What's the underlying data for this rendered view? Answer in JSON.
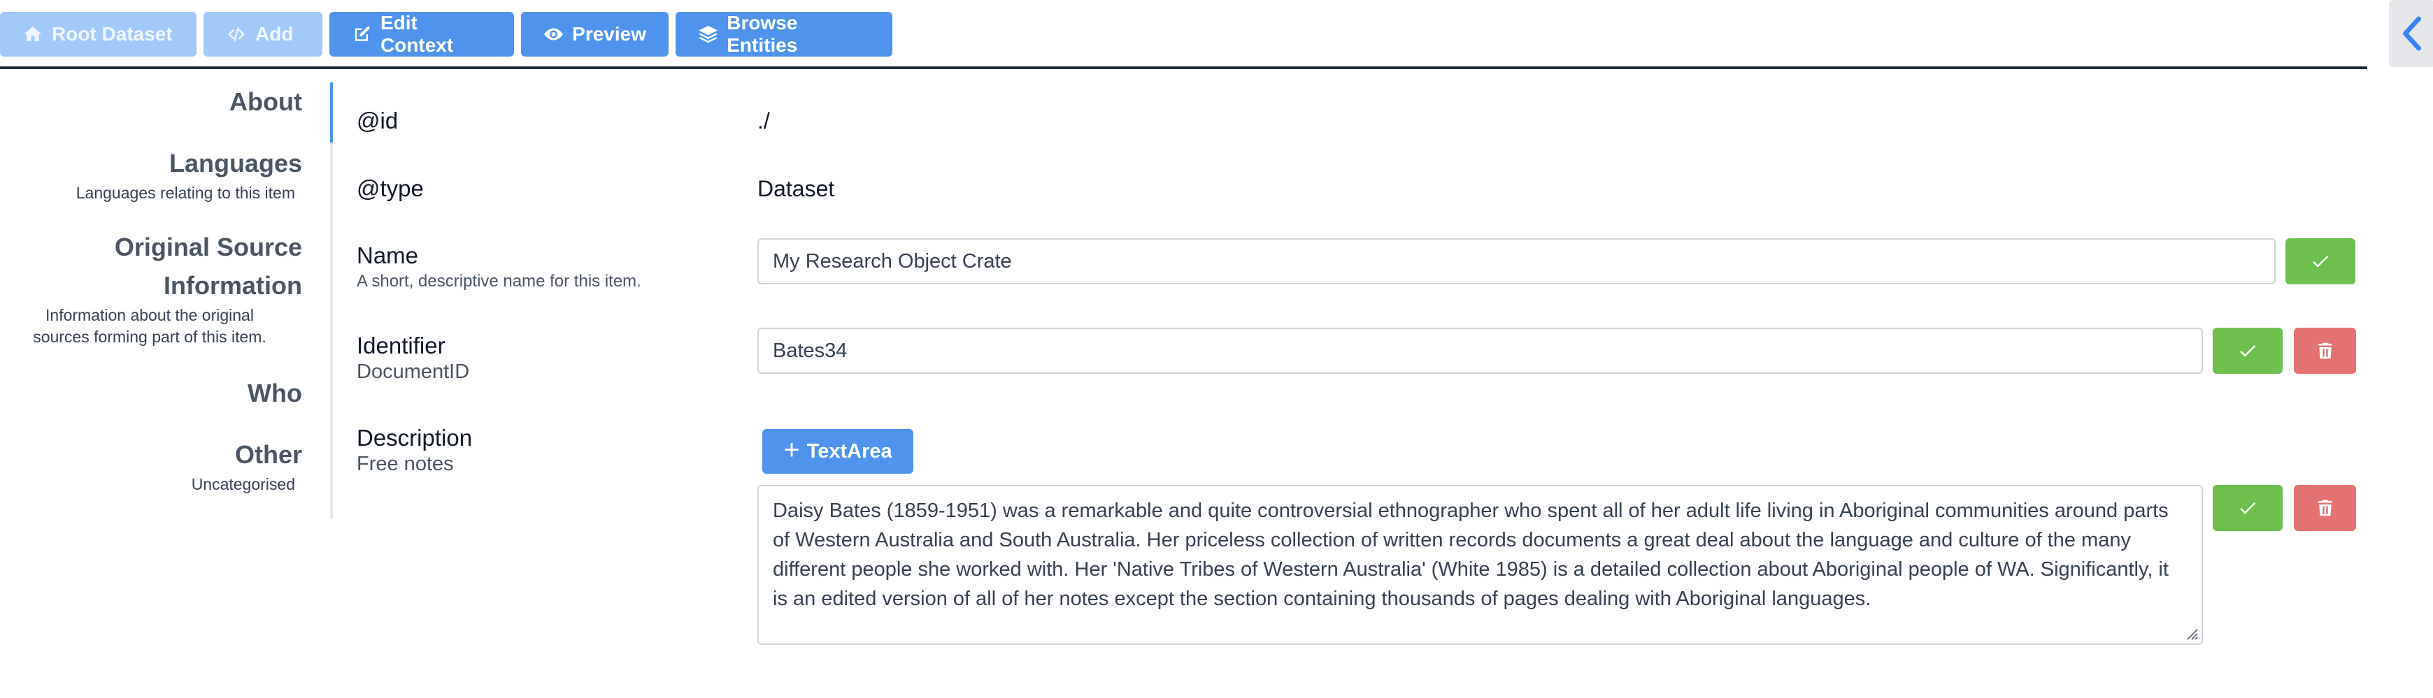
{
  "toolbar": {
    "root_dataset": "Root Dataset",
    "add": "Add",
    "edit_context": "Edit Context",
    "preview": "Preview",
    "browse_entities": "Browse Entities"
  },
  "sidebar": {
    "items": [
      {
        "title": "About",
        "desc": ""
      },
      {
        "title": "Languages",
        "desc": "Languages relating to this item"
      },
      {
        "title_line1": "Original Source",
        "title_line2": "Information",
        "desc_line1": "Information about the original",
        "desc_line2": "sources forming part of this item."
      },
      {
        "title": "Who",
        "desc": ""
      },
      {
        "title": "Other",
        "desc": "Uncategorised"
      }
    ]
  },
  "entity": {
    "id": {
      "label": "@id",
      "value": "./"
    },
    "type": {
      "label": "@type",
      "value": "Dataset"
    },
    "name": {
      "label": "Name",
      "help": "A short, descriptive name for this item.",
      "value": "My Research Object Crate"
    },
    "identifier": {
      "label": "Identifier",
      "help": "DocumentID",
      "value": "Bates34"
    },
    "description": {
      "label": "Description",
      "help": "Free notes",
      "add_label": "TextArea",
      "value": "Daisy Bates (1859-1951) was a remarkable and quite controversial ethnographer who spent all of her adult life living in Aboriginal communities around parts of Western Australia and South Australia. Her priceless collection of written records documents a great deal about the language and culture of the many different people she worked with. Her 'Native Tribes of Western Australia' (White 1985) is a detailed collection about Aboriginal people of WA. Significantly, it is an edited version of all of her notes except the section containing thousands of pages dealing with Aboriginal languages."
    }
  },
  "colors": {
    "primary": "#4f93ed",
    "primary_disabled": "#a3c9f9",
    "success": "#6fbf4f",
    "danger": "#e47272"
  }
}
